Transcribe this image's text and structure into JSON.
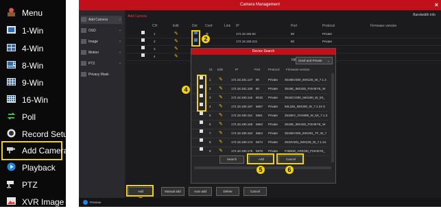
{
  "menu": {
    "items": [
      {
        "label": "Menu",
        "icon": "menu-icon"
      },
      {
        "label": "1-Win",
        "icon": "single-window-icon"
      },
      {
        "label": "4-Win",
        "icon": "quad-window-icon"
      },
      {
        "label": "8-Win",
        "icon": "eight-window-icon"
      },
      {
        "label": "9-Win",
        "icon": "nine-window-icon"
      },
      {
        "label": "16-Win",
        "icon": "sixteen-window-icon"
      },
      {
        "label": "Poll",
        "icon": "poll-icon"
      },
      {
        "label": "Record Setup",
        "icon": "record-icon"
      },
      {
        "label": "Add Camera",
        "icon": "camera-icon"
      },
      {
        "label": "Playback",
        "icon": "playback-icon"
      },
      {
        "label": "PTZ",
        "icon": "ptz-icon"
      },
      {
        "label": "XVR Image",
        "icon": "image-icon"
      }
    ],
    "selected": "Add Camera",
    "highlight_color": "#f4d400"
  },
  "window": {
    "title": "Camera Management",
    "close": "×",
    "bandwidth_label": "Bandwidth info",
    "accent_color": "#c0101a"
  },
  "leftnav": {
    "items": [
      {
        "label": "Add Camera"
      },
      {
        "label": "OSD"
      },
      {
        "label": "Image"
      },
      {
        "label": "Motion"
      },
      {
        "label": "PTZ"
      },
      {
        "label": "Privacy Mask"
      }
    ],
    "start_label": "Preview"
  },
  "table": {
    "section_label": "Add Camera",
    "headers": [
      "CH",
      "Edit",
      "Del",
      "Conf",
      "Link",
      "IP",
      "Port",
      "Protocol",
      "Firmware version"
    ],
    "rows": [
      {
        "ch": "1",
        "ip": "172.18.194.94",
        "port": "80",
        "protocol": "Private"
      },
      {
        "ch": "2",
        "ip": "172.18.193.221",
        "port": "80",
        "protocol": "Private"
      },
      {
        "ch": "3",
        "ip": "",
        "port": "",
        "protocol": "Private"
      },
      {
        "ch": "4",
        "ip": "",
        "port": "",
        "protocol": "Private"
      }
    ]
  },
  "device_search": {
    "title": "Device Search",
    "filter_label": "Filter",
    "filter_value": "Onvif and Private",
    "headers": [
      "",
      "01",
      "Edit",
      "IP",
      "Port",
      "Protocol",
      "Firmware version"
    ],
    "rows": [
      {
        "idx": "1",
        "ip": "172.18.191.147",
        "port": "80",
        "protocol": "Private",
        "firmware": "3518EV300_IMX225_W_7.1.4"
      },
      {
        "idx": "2",
        "ip": "172.18.191.180",
        "port": "80",
        "protocol": "Private",
        "firmware": "3516E_IMX325_FISHEYE_W"
      },
      {
        "idx": "3",
        "ip": "172.18.190.115",
        "port": "9015",
        "protocol": "Private",
        "firmware": "3516CV300_IMX290_W_5X_"
      },
      {
        "idx": "4",
        "ip": "172.18.190.197",
        "port": "6667",
        "protocol": "Private",
        "firmware": "IML326_IMX290_W_7.1.24 S"
      },
      {
        "idx": "5",
        "ip": "172.18.190.151",
        "port": "6661",
        "protocol": "Private",
        "firmware": "3516EV_OV4689_W_5X_7.1.3"
      },
      {
        "idx": "6",
        "ip": "172.18.190.169",
        "port": "6663",
        "protocol": "Private",
        "firmware": "3516E_IMX326_FISHEYE_W"
      },
      {
        "idx": "7",
        "ip": "172.18.190.154",
        "port": "6664",
        "protocol": "Private",
        "firmware": "3516EV300_IMX291_TF_W_7"
      },
      {
        "idx": "8",
        "ip": "172.18.190.174",
        "port": "6674",
        "protocol": "Private",
        "firmware": "2610V301_IMX229_W_7.1.24"
      },
      {
        "idx": "9",
        "ip": "172.18.190.175",
        "port": "5875",
        "protocol": "Private",
        "firmware": "FH8830_AR0330_FISHEYE_"
      }
    ],
    "buttons": {
      "search": "Search",
      "add": "Add",
      "cancel": "Cancel"
    }
  },
  "bottom_buttons": {
    "add": "Add",
    "manual_add": "Manual add",
    "auto_add": "Auto add",
    "delete": "Delete",
    "cancel": "Cancel"
  },
  "badges": [
    "1",
    "2",
    "3",
    "4",
    "5",
    "6"
  ]
}
